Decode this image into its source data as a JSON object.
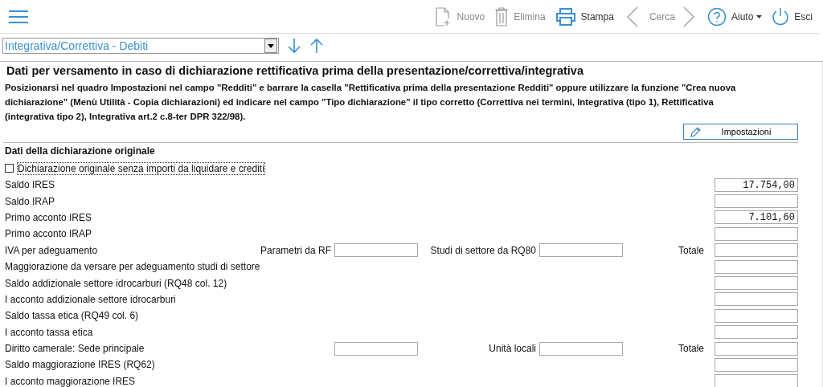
{
  "toolbar": {
    "items": [
      {
        "kind": "new",
        "label": "Nuovo",
        "disabled": true
      },
      {
        "kind": "delete",
        "label": "Elimina",
        "disabled": true
      },
      {
        "kind": "print",
        "label": "Stampa",
        "disabled": false
      },
      {
        "kind": "prev",
        "disabled": true
      },
      {
        "kind": "search",
        "label": "Cerca",
        "disabled": true
      },
      {
        "kind": "next",
        "disabled": true
      },
      {
        "kind": "help",
        "label": "Aiuto",
        "disabled": false
      },
      {
        "kind": "exit",
        "label": "Esci",
        "disabled": false
      }
    ]
  },
  "selector": {
    "value": "Integrativa/Correttiva - Debiti"
  },
  "section": {
    "title": "Dati per versamento in caso di dichiarazione rettificativa prima della presentazione/correttiva/integrativa",
    "note": "Posizionarsi nel quadro Impostazioni nel campo \"Redditi\" e barrare la casella \"Rettificativa prima della presentazione Redditi\" oppure utilizzare la funzione \"Crea nuova dichiarazione\" (Menù Utilità - Copia dichiarazioni) ed indicare nel campo \"Tipo dichiarazione\" il tipo corretto (Correttiva nei termini, Integrativa (tipo 1), Rettificativa (integrativa tipo 2), Integrativa art.2 c.8-ter DPR 322/98).",
    "button": "Impostazioni"
  },
  "subtitle": "Dati della dichiarazione originale",
  "checkbox": {
    "label": "Dichiarazione originale senza importi da liquidare e crediti",
    "checked": false
  },
  "rows": [
    {
      "label": "Saldo IRES",
      "value": "17.754,00"
    },
    {
      "label": "Saldo IRAP"
    },
    {
      "label": "Primo acconto IRES",
      "value": "7.101,60"
    },
    {
      "label": "Primo acconto IRAP"
    },
    {
      "label": "IVA per adeguamento",
      "slots": [
        {
          "kind": "labeled",
          "label": "Parametri da RF"
        },
        {
          "kind": "labeled",
          "label": "Studi di settore da RQ80"
        }
      ],
      "total_label": "Totale"
    },
    {
      "label": "Maggiorazione da versare per adeguamento studi di settore"
    },
    {
      "label": "Saldo addizionale settore idrocarburi (RQ48 col. 12)"
    },
    {
      "label": "I acconto addizionale settore idrocarburi"
    },
    {
      "label": "Saldo tassa etica (RQ49 col. 6)"
    },
    {
      "label": "I acconto tassa etica"
    },
    {
      "label": "Diritto camerale: Sede principale",
      "slots": [
        {
          "kind": "field"
        },
        {
          "kind": "labeled",
          "label": "Unità locali"
        }
      ],
      "total_label": "Totale"
    },
    {
      "label": "Saldo maggiorazione IRES (RQ62)"
    },
    {
      "label": "I acconto maggiorazione IRES"
    }
  ]
}
